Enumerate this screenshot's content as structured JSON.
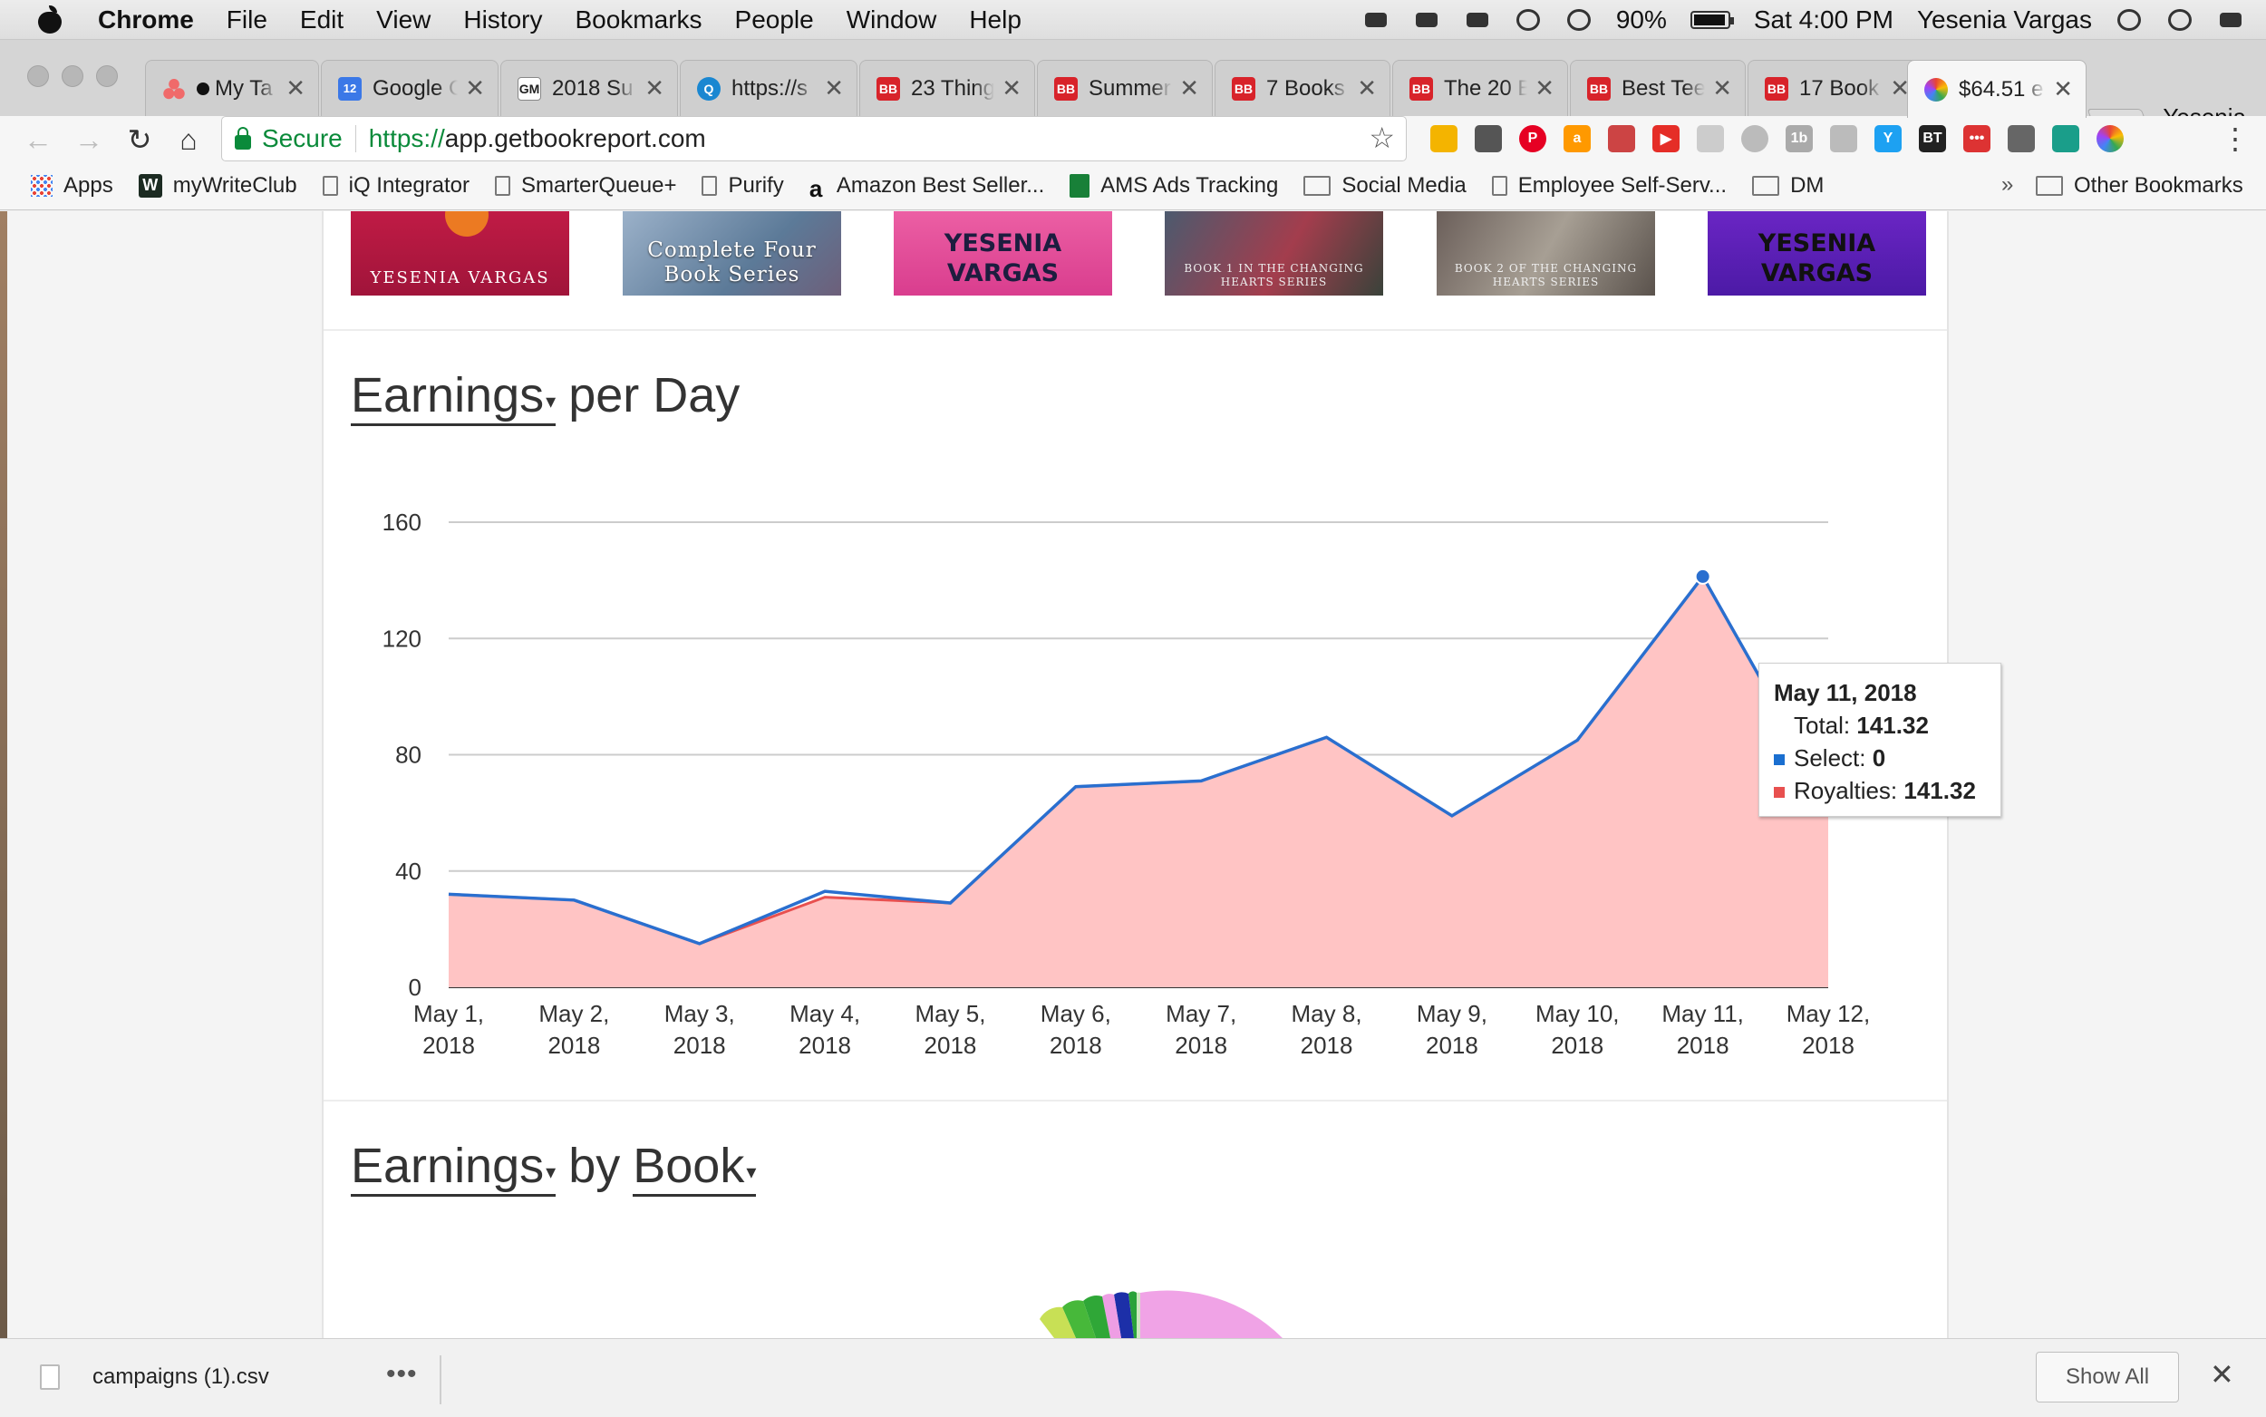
{
  "menubar": {
    "app": "Chrome",
    "items": [
      "File",
      "Edit",
      "View",
      "History",
      "Bookmarks",
      "People",
      "Window",
      "Help"
    ],
    "battery": "90%",
    "clock": "Sat 4:00 PM",
    "user": "Yesenia Vargas"
  },
  "tabs": [
    {
      "title": "My Ta",
      "icon": "asana-icon"
    },
    {
      "title": "Google C",
      "icon": "calendar-icon",
      "badge": "12"
    },
    {
      "title": "2018 Su",
      "icon": "gm-icon",
      "badge": "GM"
    },
    {
      "title": "https://s",
      "icon": "q-icon",
      "badge": "Q"
    },
    {
      "title": "23 Thing",
      "icon": "bb-icon",
      "badge": "BB"
    },
    {
      "title": "Summer",
      "icon": "bb-icon",
      "badge": "BB"
    },
    {
      "title": "7 Books",
      "icon": "bb-icon",
      "badge": "BB"
    },
    {
      "title": "The 20 B",
      "icon": "bb-icon",
      "badge": "BB"
    },
    {
      "title": "Best Tee",
      "icon": "bb-icon",
      "badge": "BB"
    },
    {
      "title": "17 Book",
      "icon": "bb-icon",
      "badge": "BB"
    },
    {
      "title": "$64.51 e",
      "icon": "bookreport-icon",
      "active": true
    }
  ],
  "profile": "Yesenia",
  "omnibox": {
    "secure_label": "Secure",
    "scheme": "https://",
    "host": "app.getbookreport.com"
  },
  "bookmarks": {
    "items": [
      {
        "label": "Apps",
        "icon": "apps-grid-icon"
      },
      {
        "label": "myWriteClub",
        "icon": "w-icon"
      },
      {
        "label": "iQ Integrator",
        "icon": "page-icon"
      },
      {
        "label": "SmarterQueue+",
        "icon": "page-icon"
      },
      {
        "label": "Purify",
        "icon": "page-icon"
      },
      {
        "label": "Amazon Best Seller...",
        "icon": "amazon-icon"
      },
      {
        "label": "AMS Ads Tracking",
        "icon": "sheets-icon"
      },
      {
        "label": "Social Media",
        "icon": "folder-icon"
      },
      {
        "label": "Employee Self-Serv...",
        "icon": "page-icon"
      },
      {
        "label": "DM",
        "icon": "folder-icon"
      }
    ],
    "overflow": "»",
    "other": "Other Bookmarks"
  },
  "covers": [
    {
      "text": "YESENIA VARGAS"
    },
    {
      "text": "Complete Four Book Series"
    },
    {
      "text": "YESENIA VARGAS"
    },
    {
      "text": "BOOK 1 IN THE CHANGING HEARTS SERIES"
    },
    {
      "text": "BOOK 2 OF THE CHANGING HEARTS SERIES"
    },
    {
      "text": "YESENIA VARGAS"
    }
  ],
  "earnings_day": {
    "metric": "Earnings",
    "rest": "per Day"
  },
  "earnings_book": {
    "metric": "Earnings",
    "by": "by",
    "dimension": "Book"
  },
  "chart_data": {
    "type": "area",
    "x": [
      "May 1, 2018",
      "May 2, 2018",
      "May 3, 2018",
      "May 4, 2018",
      "May 5, 2018",
      "May 6, 2018",
      "May 7, 2018",
      "May 8, 2018",
      "May 9, 2018",
      "May 10, 2018",
      "May 11, 2018",
      "May 12, 2018"
    ],
    "series": [
      {
        "name": "Royalties",
        "color": "#e8504f",
        "fill": "#ffc4c4",
        "values": [
          32,
          30,
          15,
          31,
          29,
          69,
          71,
          86,
          59,
          85,
          141.32,
          65
        ]
      },
      {
        "name": "Select",
        "color": "#1a6fd0",
        "values": [
          0,
          0,
          0,
          0,
          0,
          0,
          0,
          0,
          0,
          0,
          0,
          0
        ]
      },
      {
        "name": "Total",
        "color": "#2a6fcf",
        "values": [
          32,
          30,
          15,
          33,
          29,
          69,
          71,
          86,
          59,
          85,
          141.32,
          65
        ]
      }
    ],
    "yticks": [
      0,
      40,
      80,
      120,
      160
    ],
    "ylim": [
      0,
      160
    ],
    "grid": true,
    "tooltip": {
      "date": "May 11, 2018",
      "total_label": "Total:",
      "total_value": "141.32",
      "select_label": "Select:",
      "select_value": "0",
      "royalties_label": "Royalties:",
      "royalties_value": "141.32"
    }
  },
  "download_shelf": {
    "file": "campaigns (1).csv",
    "more": "•••",
    "show_all": "Show All",
    "close": "✕"
  }
}
